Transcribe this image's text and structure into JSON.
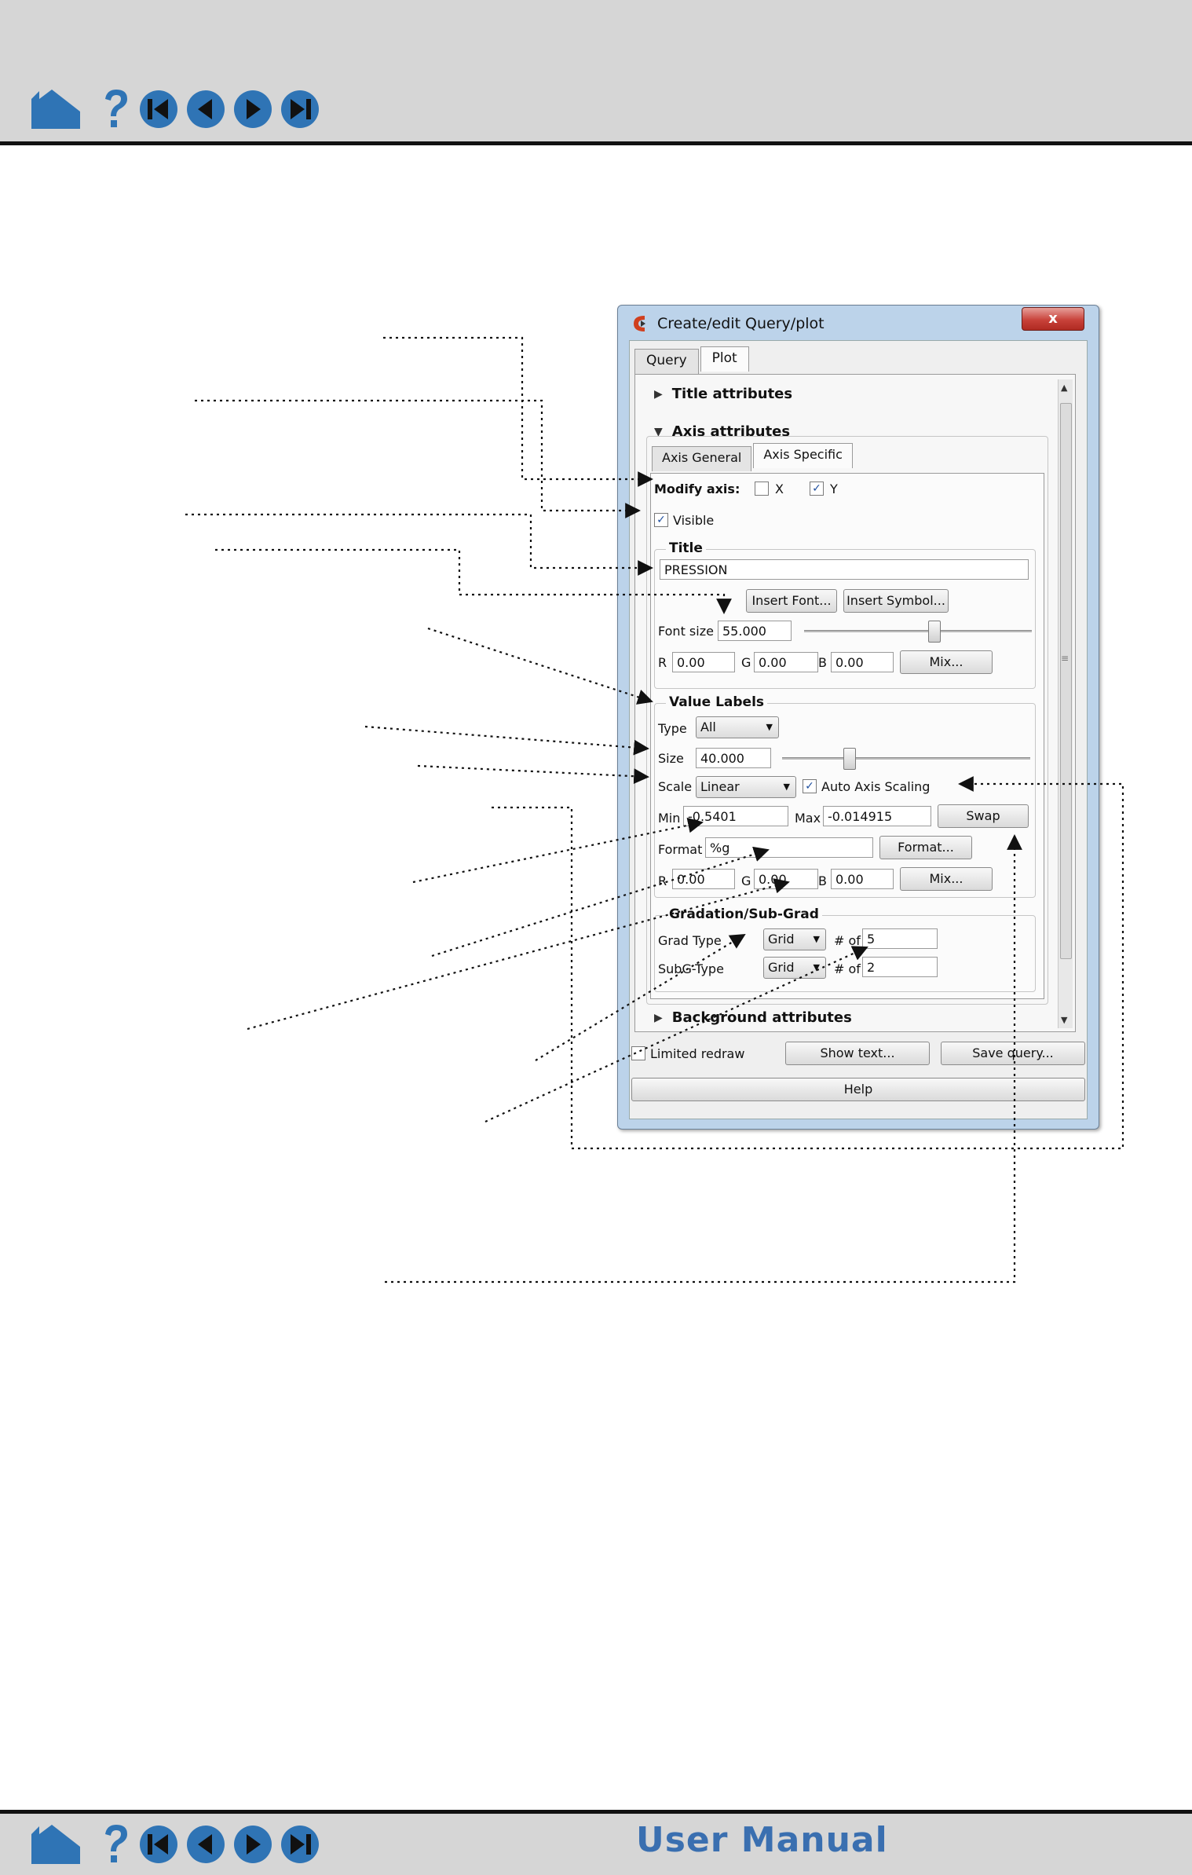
{
  "footer": {
    "title": "User Manual"
  },
  "nav_icons": [
    "home-icon",
    "help-icon",
    "first-page-icon",
    "previous-page-icon",
    "next-page-icon",
    "last-page-icon"
  ],
  "colors": {
    "nav_blue": "#2f74b5",
    "bar_gray": "#d6d6d6",
    "window_frame": "#bcd3ea",
    "close_red": "#c8423a",
    "check_blue": "#1f4f9f"
  },
  "dialog": {
    "title": "Create/edit Query/plot",
    "close_label": "x",
    "tabs": [
      "Query",
      "Plot"
    ],
    "active_tab": "Plot",
    "sections": {
      "title_attributes": "Title attributes",
      "axis_attributes": "Axis attributes",
      "background_attributes": "Background attributes"
    },
    "axis_tabs": [
      "Axis General",
      "Axis Specific"
    ],
    "active_axis_tab": "Axis Specific",
    "modify_axis": {
      "label": "Modify axis:",
      "x_label": "X",
      "x_checked": false,
      "y_label": "Y",
      "y_checked": true
    },
    "visible": {
      "label": "Visible",
      "checked": true
    },
    "title_group": {
      "heading": "Title",
      "value": "PRESSION",
      "insert_font": "Insert Font...",
      "insert_symbol": "Insert Symbol...",
      "font_size_label": "Font size",
      "font_size": "55.000",
      "font_size_slider_level": 0.55,
      "r_label": "R",
      "r": "0.00",
      "g_label": "G",
      "g": "0.00",
      "b_label": "B",
      "b": "0.00",
      "mix": "Mix..."
    },
    "value_labels": {
      "heading": "Value Labels",
      "type_label": "Type",
      "type": "All",
      "size_label": "Size",
      "size": "40.000",
      "size_slider_level": 0.4,
      "scale_label": "Scale",
      "scale": "Linear",
      "auto_scaling_label": "Auto Axis Scaling",
      "auto_scaling_checked": true,
      "min_label": "Min",
      "min": "-0.5401",
      "max_label": "Max",
      "max": "-0.014915",
      "swap": "Swap",
      "format_label": "Format",
      "format": "%g",
      "format_button": "Format...",
      "r_label": "R",
      "r": "0.00",
      "g_label": "G",
      "g": "0.00",
      "b_label": "B",
      "b": "0.00",
      "mix": "Mix..."
    },
    "gradation": {
      "heading": "Gradation/Sub-Grad",
      "grad_type_label": "Grad Type",
      "grad_type": "Grid",
      "num_of_label": "# of",
      "grad_count": "5",
      "subg_type_label": "SubG-Type",
      "subg_type": "Grid",
      "subg_count": "2"
    },
    "bottom": {
      "limited_redraw": "Limited redraw",
      "limited_redraw_checked": false,
      "show_text": "Show text...",
      "save_query": "Save query...",
      "help": "Help"
    }
  }
}
